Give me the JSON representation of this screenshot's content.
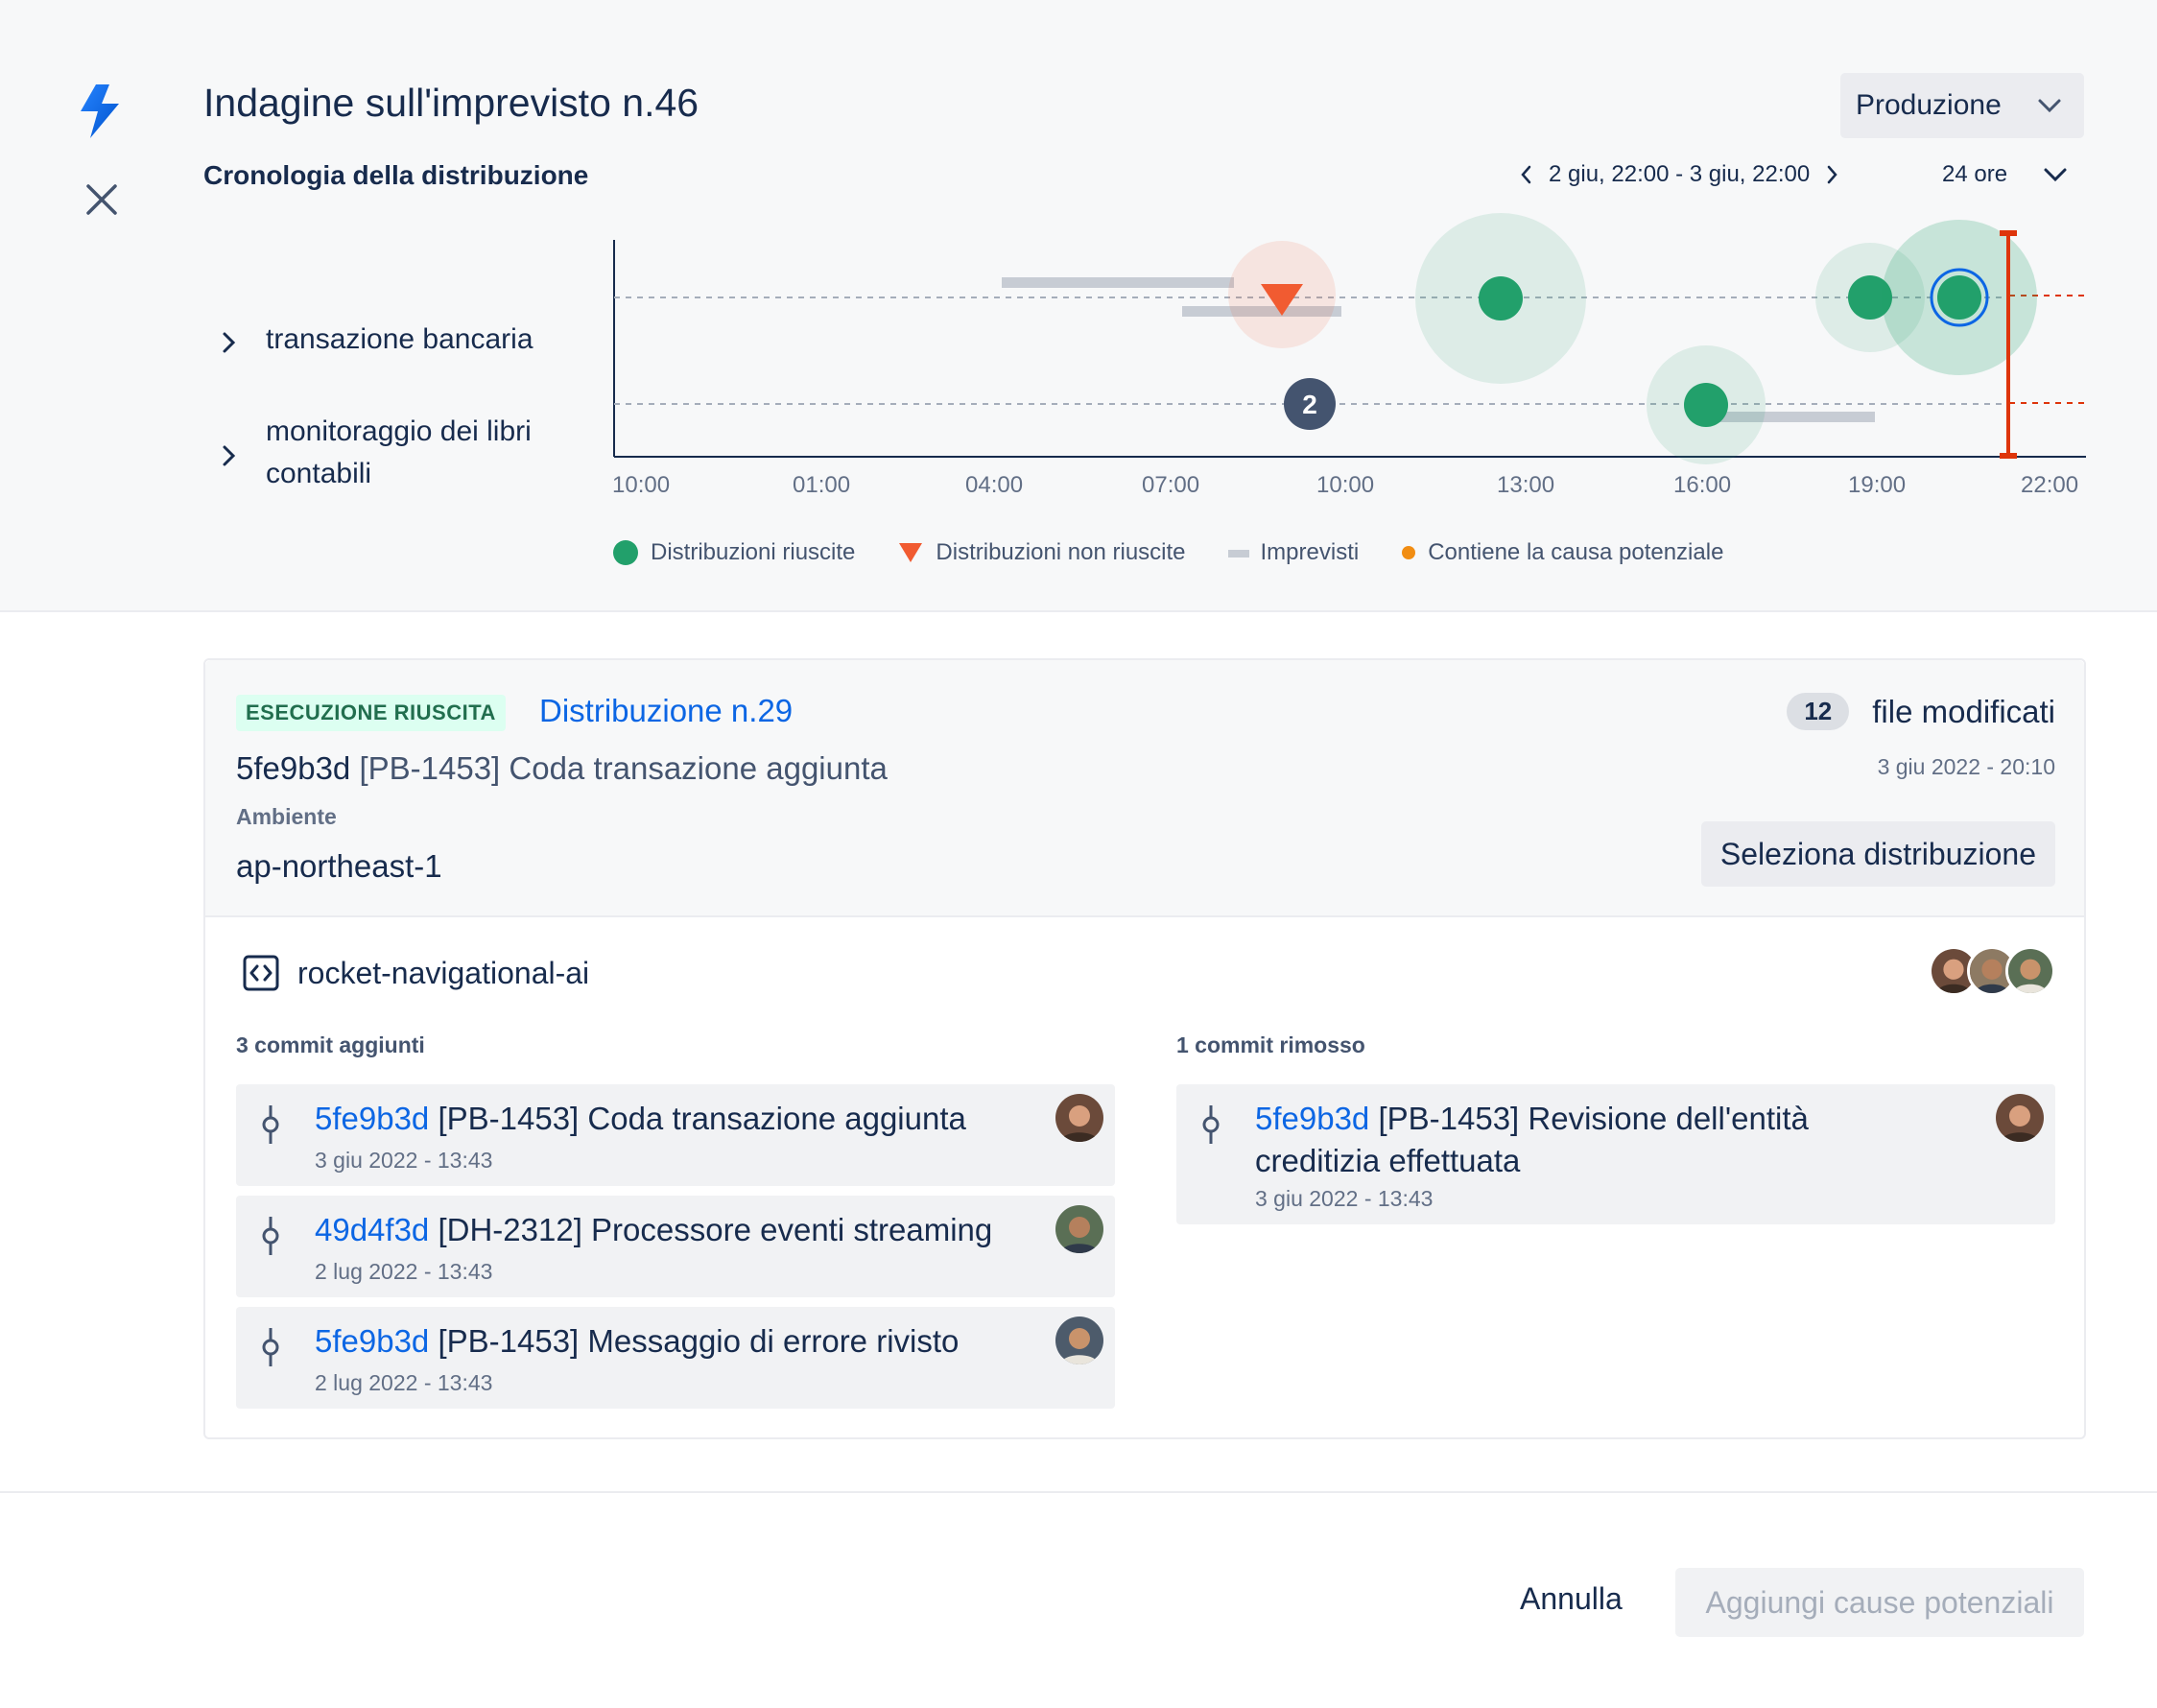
{
  "header": {
    "title": "Indagine sull'imprevisto n.46",
    "environment": "Produzione",
    "timeline_title": "Cronologia della distribuzione",
    "range": "2 giu, 22:00 - 3 giu, 22:00",
    "span": "24 ore"
  },
  "rows": [
    {
      "label": "transazione bancaria"
    },
    {
      "label_line1": "monitoraggio dei libri",
      "label_line2": "contabili"
    }
  ],
  "timeline": {
    "ticks": [
      "10:00",
      "01:00",
      "04:00",
      "07:00",
      "10:00",
      "13:00",
      "16:00",
      "19:00",
      "22:00"
    ],
    "cluster_count": "2"
  },
  "legend": {
    "success": "Distribuzioni riuscite",
    "failed": "Distribuzioni non riuscite",
    "incidents": "Imprevisti",
    "cause": "Contiene la causa potenziale"
  },
  "colors": {
    "success": "#22a06b",
    "failed": "#f15b31",
    "incident": "#c7ccd4",
    "cause": "#f18d13",
    "link": "#0c66e4",
    "marker": "#de350b"
  },
  "deployment": {
    "status": "ESECUZIONE RIUSCITA",
    "name": "Distribuzione n.29",
    "sha": "5fe9b3d",
    "message": "[PB-1453] Coda transazione aggiunta",
    "env_label": "Ambiente",
    "env_value": "ap-northeast-1",
    "files_count": "12",
    "files_label": "file modificati",
    "date": "3 giu 2022 - 20:10",
    "select_button": "Seleziona distribuzione"
  },
  "repo": {
    "name": "rocket-navigational-ai"
  },
  "added": {
    "label": "3 commit aggiunti",
    "commits": [
      {
        "hash": "5fe9b3d",
        "message": "[PB-1453] Coda transazione aggiunta",
        "date": "3 giu 2022 - 13:43"
      },
      {
        "hash": "49d4f3d",
        "message": "[DH-2312] Processore eventi streaming",
        "date": "2 lug 2022 - 13:43"
      },
      {
        "hash": "5fe9b3d",
        "message": "[PB-1453] Messaggio di errore rivisto",
        "date": "2 lug 2022 - 13:43"
      }
    ]
  },
  "removed": {
    "label": "1 commit rimosso",
    "commits": [
      {
        "hash": "5fe9b3d",
        "message_line1": "[PB-1453] Revisione dell'entità",
        "message_line2": "creditizia effettuata",
        "date": "3 giu 2022 - 13:43"
      }
    ]
  },
  "footer": {
    "cancel": "Annulla",
    "add": "Aggiungi cause potenziali"
  }
}
